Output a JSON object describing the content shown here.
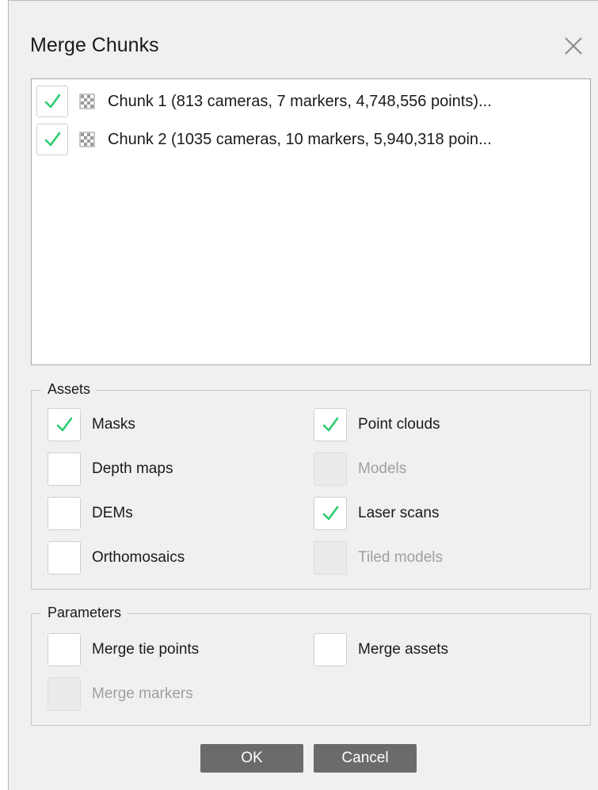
{
  "window": {
    "title": "Merge Chunks",
    "close_icon": "close-icon"
  },
  "chunks": [
    {
      "checked": true,
      "label": "Chunk 1 (813 cameras, 7 markers, 4,748,556 points)..."
    },
    {
      "checked": true,
      "label": "Chunk 2 (1035 cameras, 10 markers, 5,940,318 poin..."
    }
  ],
  "assets": {
    "legend": "Assets",
    "items": [
      {
        "label": "Masks",
        "checked": true,
        "enabled": true
      },
      {
        "label": "Point clouds",
        "checked": true,
        "enabled": true
      },
      {
        "label": "Depth maps",
        "checked": false,
        "enabled": true
      },
      {
        "label": "Models",
        "checked": false,
        "enabled": false
      },
      {
        "label": "DEMs",
        "checked": false,
        "enabled": true
      },
      {
        "label": "Laser scans",
        "checked": true,
        "enabled": true
      },
      {
        "label": "Orthomosaics",
        "checked": false,
        "enabled": true
      },
      {
        "label": "Tiled models",
        "checked": false,
        "enabled": false
      }
    ]
  },
  "parameters": {
    "legend": "Parameters",
    "items": [
      {
        "label": "Merge tie points",
        "checked": false,
        "enabled": true
      },
      {
        "label": "Merge assets",
        "checked": false,
        "enabled": true
      },
      {
        "label": "Merge markers",
        "checked": false,
        "enabled": false
      }
    ]
  },
  "buttons": {
    "ok": "OK",
    "cancel": "Cancel"
  },
  "colors": {
    "check": "#2ecc71",
    "button_bg": "#6b6b6b",
    "dialog_bg": "#f0f0f0"
  }
}
